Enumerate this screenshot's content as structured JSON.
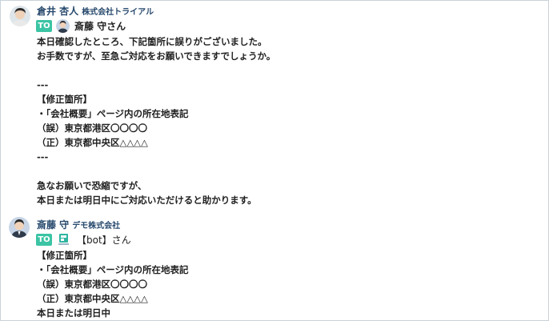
{
  "messages": [
    {
      "sender": "倉井 杏人",
      "org": "株式会社トライアル",
      "to_badge": "TO",
      "to_name": "斎藤 守さん",
      "lines": [
        "本日確認したところ、下記箇所に誤りがございました。",
        "お手数ですが、至急ご対応をお願いできますでしょうか。",
        "",
        "---",
        "【修正箇所】",
        "・「会社概要」ページ内の所在地表記",
        "（誤）東京都港区〇〇〇〇",
        "（正）東京都中央区△△△△",
        "---",
        "",
        "急なお願いで恐縮ですが、",
        "本日または明日中にご対応いただけると助かります。"
      ]
    },
    {
      "sender": "斎藤 守",
      "org": "デモ株式会社",
      "to_badge": "TO",
      "to_name": "【bot】さん",
      "lines": [
        "【修正箇所】",
        "・「会社概要」ページ内の所在地表記",
        "（誤）東京都港区〇〇〇〇",
        "（正）東京都中央区△△△△",
        "本日または明日中"
      ]
    }
  ],
  "colors": {
    "to_badge": "#3bc4a4",
    "sender": "#27496d",
    "text": "#1f1f1f"
  },
  "icons": {
    "sender1_avatar": "user-avatar-kurai",
    "sender2_avatar": "user-avatar-saito",
    "to1_avatar": "user-avatar-saito",
    "to2_avatar": "bot-icon"
  }
}
